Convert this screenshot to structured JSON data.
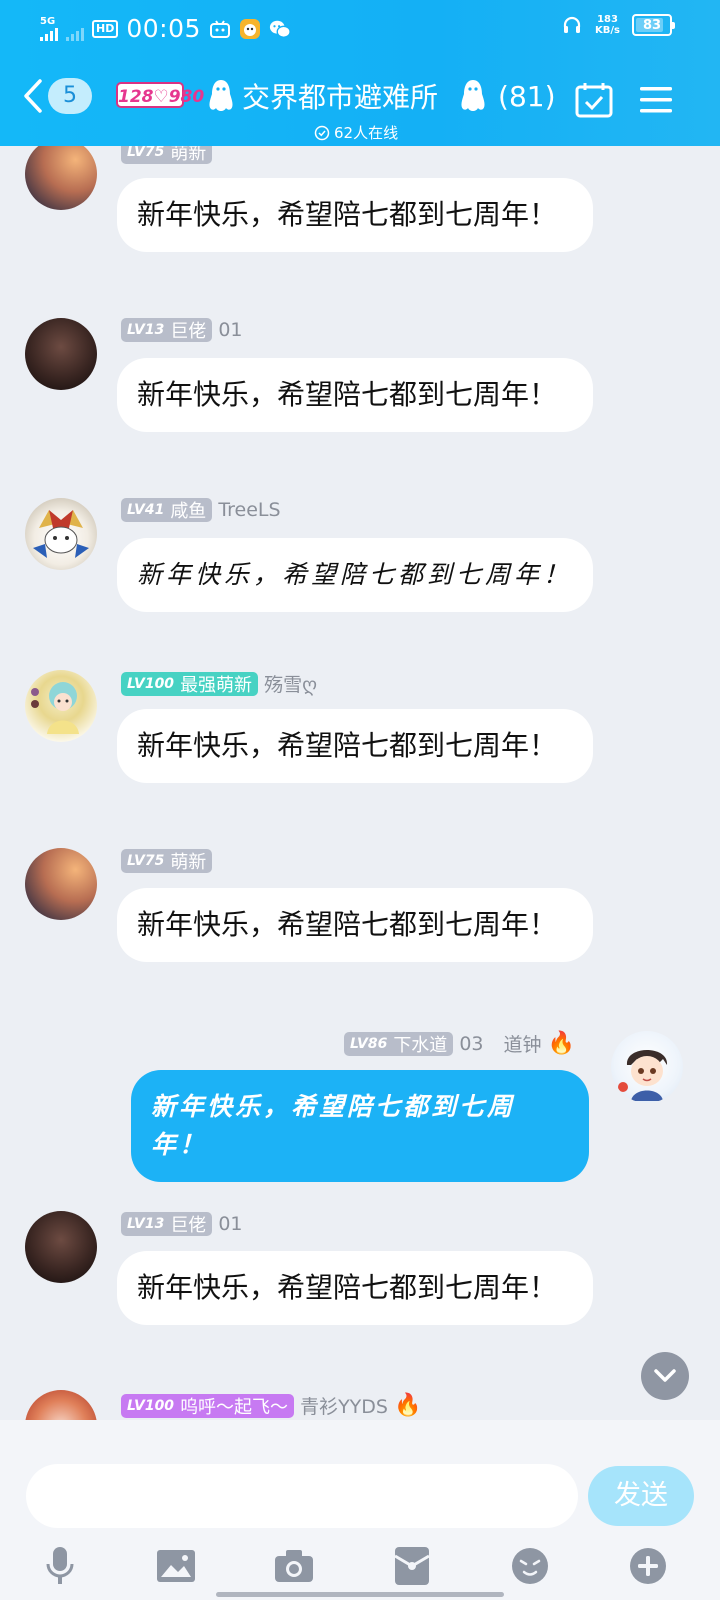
{
  "status_bar": {
    "network": "5G",
    "clock": "00:05",
    "hd": "HD",
    "speed_value": "183",
    "speed_unit": "KB/s",
    "battery": "83",
    "battery_level": 0.83
  },
  "header": {
    "unread_count": "5",
    "logo_text": "128♡980",
    "title": "交界都市避难所",
    "member_count": "(81)",
    "online_text": "62人在线"
  },
  "messages": [
    {
      "badge_lv": "LV75",
      "badge_title": "萌新",
      "name": "",
      "text": "新年快乐，希望陪七都到七周年！",
      "avatar": "avatar-sunset-figure"
    },
    {
      "badge_lv": "LV13",
      "badge_title": "巨佬",
      "name": "01",
      "text": "新年快乐，希望陪七都到七周年！",
      "avatar": "avatar-dark-portrait"
    },
    {
      "badge_lv": "LV41",
      "badge_title": "咸鱼",
      "name": "TreeLS",
      "text": "新年快乐，希望陪七都到七周年！",
      "avatar": "avatar-cat-mecha"
    },
    {
      "badge_lv": "LV100",
      "badge_title": "最强萌新",
      "name": "殇雪ღ",
      "text": "新年快乐，希望陪七都到七周年！",
      "avatar": "avatar-anime-girl"
    },
    {
      "badge_lv": "LV75",
      "badge_title": "萌新",
      "name": "",
      "text": "新年快乐，希望陪七都到七周年！",
      "avatar": "avatar-sunset-figure"
    },
    {
      "badge_lv": "LV86",
      "badge_title": "下水道",
      "name_prefix": "03",
      "name": "道钟",
      "text": "新年快乐，希望陪七都到七周年！",
      "avatar": "avatar-anime-boy",
      "self": true
    },
    {
      "badge_lv": "LV13",
      "badge_title": "巨佬",
      "name": "01",
      "text": "新年快乐，希望陪七都到七周年！",
      "avatar": "avatar-dark-portrait"
    },
    {
      "badge_lv": "LV100",
      "badge_title": "呜呼～起飞～",
      "name": "青衫YYDS",
      "text": "",
      "avatar": "avatar-red-lantern"
    }
  ],
  "input": {
    "placeholder": "",
    "send_label": "发送"
  },
  "toolbar": [
    "mic-icon",
    "image-icon",
    "camera-icon",
    "red-packet-icon",
    "emoji-icon",
    "plus-icon"
  ],
  "colors": {
    "header": "#14b0f5",
    "self_bubble": "#1cb2f6",
    "send_button": "#a6e4fb",
    "badge_grey": "#b8bdca",
    "badge_teal": "#47d2c3",
    "badge_purple": "#c77af2"
  }
}
